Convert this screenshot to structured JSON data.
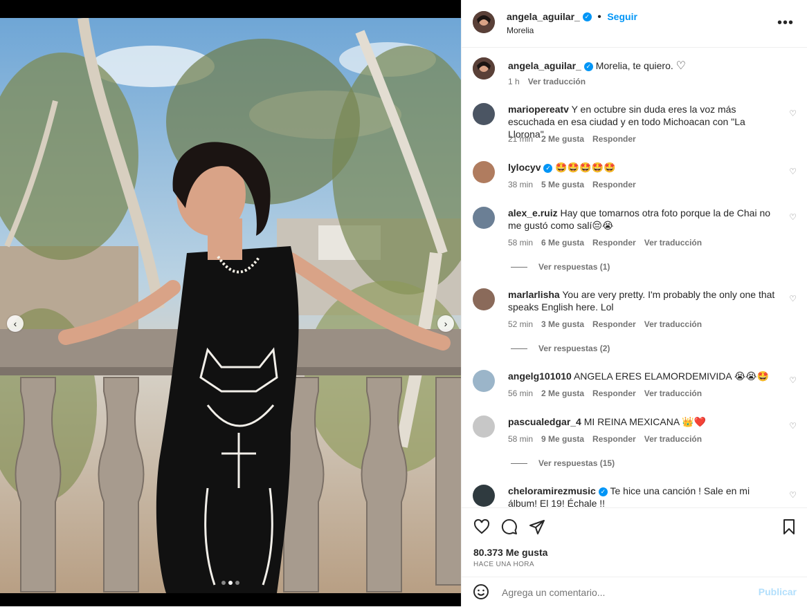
{
  "post": {
    "username": "angela_aguilar_",
    "follow_label": "Seguir",
    "location": "Morelia",
    "caption": "Morelia, te quiero.",
    "caption_time": "1 h",
    "caption_translate": "Ver traducción",
    "likes": "80.373 Me gusta",
    "time_ago": "HACE UNA HORA",
    "comment_placeholder": "Agrega un comentario...",
    "publish_label": "Publicar"
  },
  "comments": [
    {
      "user": "marioperеatv",
      "text": "Y en octubre sin duda eres la voz más escuchada en esa ciudad y en todo Michoacan con \"La Llorona\".",
      "time": "21 min",
      "likes": "2 Me gusta",
      "reply": "Responder",
      "translate": "",
      "replies": ""
    },
    {
      "user": "lylocyv",
      "text": "🤩🤩🤩🤩🤩",
      "time": "38 min",
      "likes": "5 Me gusta",
      "reply": "Responder",
      "translate": "",
      "replies": ""
    },
    {
      "user": "alex_e.ruiz",
      "text": "Hay que tomarnos otra foto porque la de Chai no me gustó como salí😔😭",
      "time": "58 min",
      "likes": "6 Me gusta",
      "reply": "Responder",
      "translate": "Ver traducción",
      "replies": "Ver respuestas (1)"
    },
    {
      "user": "marlarlisha",
      "text": "You are very pretty. I'm probably the only one that speaks English here. Lol",
      "time": "52 min",
      "likes": "3 Me gusta",
      "reply": "Responder",
      "translate": "Ver traducción",
      "replies": "Ver respuestas (2)"
    },
    {
      "user": "angelg101010",
      "text": "ANGELA ERES ELAMORDEMIVIDA 😭😭🤩",
      "time": "56 min",
      "likes": "2 Me gusta",
      "reply": "Responder",
      "translate": "Ver traducción",
      "replies": ""
    },
    {
      "user": "pascualedgar_4",
      "text": "MI REINA MEXICANA 👑❤️",
      "time": "58 min",
      "likes": "9 Me gusta",
      "reply": "Responder",
      "translate": "Ver traducción",
      "replies": "Ver respuestas (15)"
    },
    {
      "user": "cheloramirezmusic",
      "text": "Te hice una canción ! Sale en mi álbum! El 19! Échale !!",
      "time": "",
      "likes": "",
      "reply": "",
      "translate": "",
      "replies": ""
    }
  ],
  "icons": [
    "heart-icon",
    "comment-icon",
    "share-icon",
    "bookmark-icon",
    "emoji-icon",
    "more-icon",
    "verified-icon",
    "chevron-left-icon",
    "chevron-right-icon"
  ],
  "colors": {
    "accent": "#0095f6",
    "muted": "#737373",
    "publish_disabled": "#b2dffc"
  }
}
